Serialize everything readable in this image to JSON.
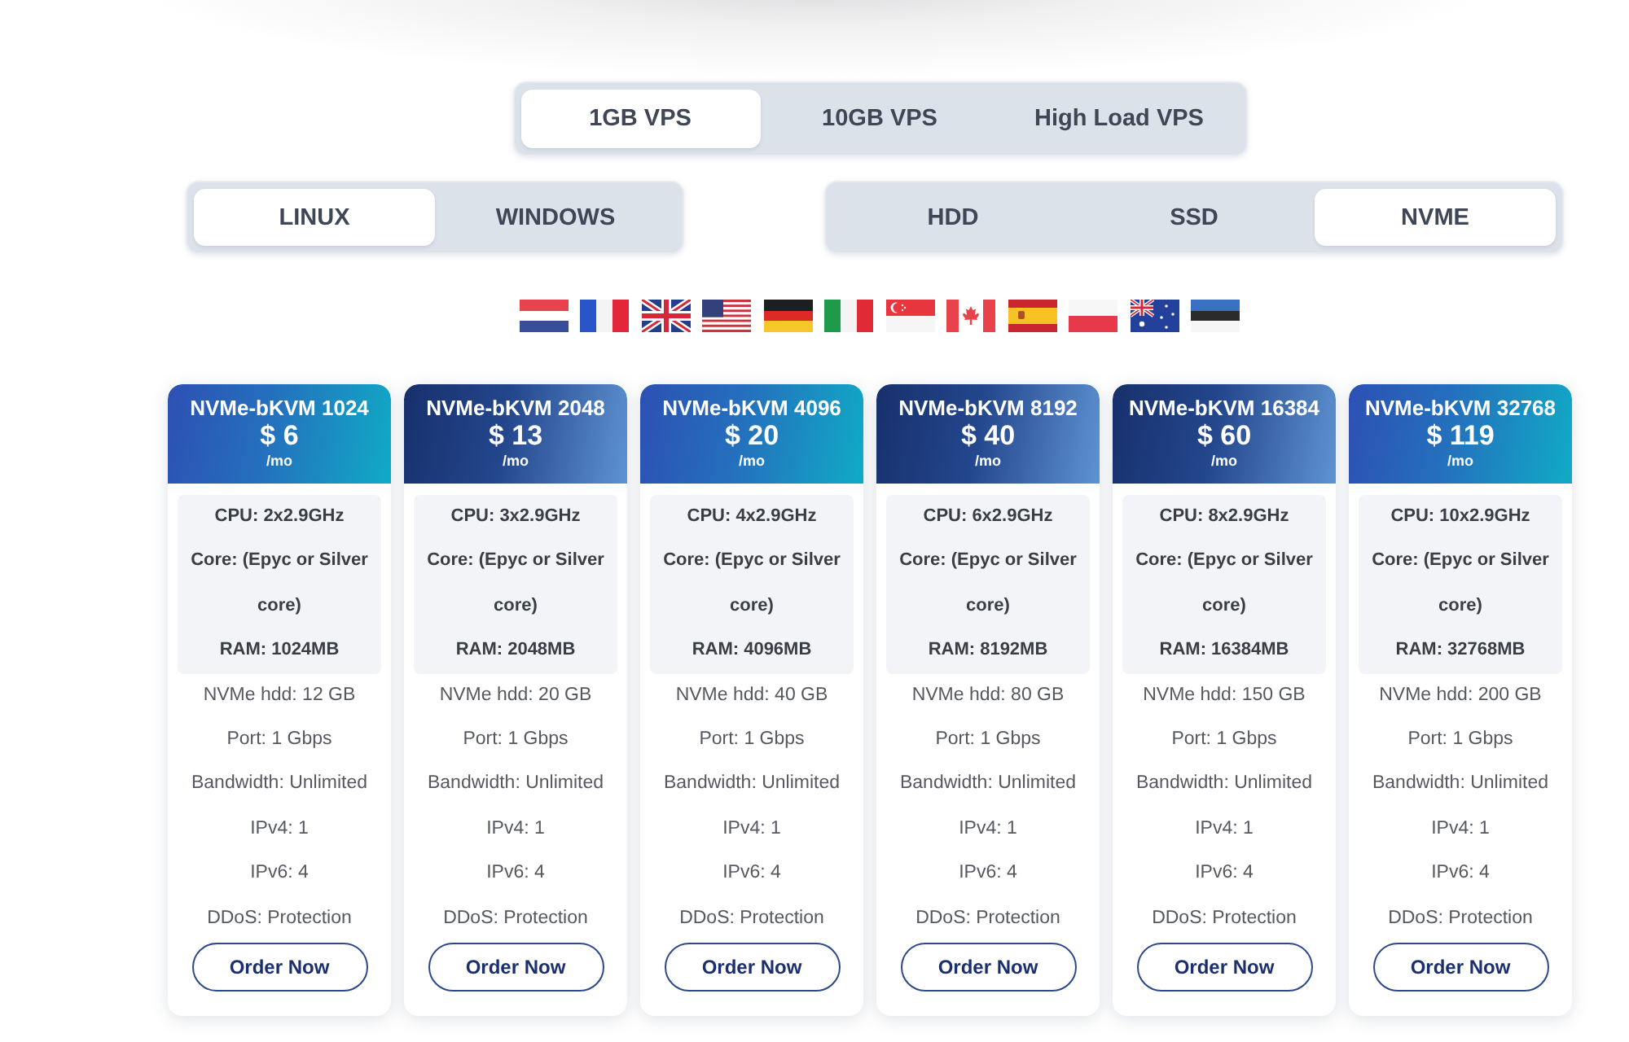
{
  "plan_tabs": [
    {
      "label": "1GB VPS",
      "selected": true
    },
    {
      "label": "10GB VPS",
      "selected": false
    },
    {
      "label": "High Load VPS",
      "selected": false
    }
  ],
  "os_tabs": [
    {
      "label": "LINUX",
      "selected": true
    },
    {
      "label": "WINDOWS",
      "selected": false
    }
  ],
  "disk_tabs": [
    {
      "label": "HDD",
      "selected": false
    },
    {
      "label": "SSD",
      "selected": false
    },
    {
      "label": "NVME",
      "selected": true
    }
  ],
  "locations": [
    {
      "kind": "nl"
    },
    {
      "kind": "fr"
    },
    {
      "kind": "gb"
    },
    {
      "kind": "us"
    },
    {
      "kind": "de"
    },
    {
      "kind": "it"
    },
    {
      "kind": "sg"
    },
    {
      "kind": "ca"
    },
    {
      "kind": "es"
    },
    {
      "kind": "pl"
    },
    {
      "kind": "au"
    },
    {
      "kind": "ee"
    }
  ],
  "plans": [
    {
      "kind": "teal",
      "name": "NVMe-bKVM 1024",
      "price": "$ 6",
      "period": "/mo",
      "highlights": [
        "CPU: 2x2.9GHz",
        "Core: (Epyc or Silver core)",
        "RAM: 1024MB"
      ],
      "specs": [
        "NVMe hdd: 12 GB",
        "Port: 1 Gbps",
        "Bandwidth: Unlimited",
        "IPv4: 1",
        "IPv6: 4",
        "DDoS: Protection"
      ],
      "button": "Order Now"
    },
    {
      "kind": "navy",
      "name": "NVMe-bKVM 2048",
      "price": "$ 13",
      "period": "/mo",
      "highlights": [
        "CPU: 3x2.9GHz",
        "Core: (Epyc or Silver core)",
        "RAM: 2048MB"
      ],
      "specs": [
        "NVMe hdd: 20 GB",
        "Port: 1 Gbps",
        "Bandwidth: Unlimited",
        "IPv4: 1",
        "IPv6: 4",
        "DDoS: Protection"
      ],
      "button": "Order Now"
    },
    {
      "kind": "teal",
      "name": "NVMe-bKVM 4096",
      "price": "$ 20",
      "period": "/mo",
      "highlights": [
        "CPU: 4x2.9GHz",
        "Core: (Epyc or Silver core)",
        "RAM: 4096MB"
      ],
      "specs": [
        "NVMe hdd: 40 GB",
        "Port: 1 Gbps",
        "Bandwidth: Unlimited",
        "IPv4: 1",
        "IPv6: 4",
        "DDoS: Protection"
      ],
      "button": "Order Now"
    },
    {
      "kind": "navy",
      "name": "NVMe-bKVM 8192",
      "price": "$ 40",
      "period": "/mo",
      "highlights": [
        "CPU: 6x2.9GHz",
        "Core: (Epyc or Silver core)",
        "RAM: 8192MB"
      ],
      "specs": [
        "NVMe hdd: 80 GB",
        "Port: 1 Gbps",
        "Bandwidth: Unlimited",
        "IPv4: 1",
        "IPv6: 4",
        "DDoS: Protection"
      ],
      "button": "Order Now"
    },
    {
      "kind": "navy",
      "name": "NVMe-bKVM 16384",
      "price": "$ 60",
      "period": "/mo",
      "highlights": [
        "CPU: 8x2.9GHz",
        "Core: (Epyc or Silver core)",
        "RAM: 16384MB"
      ],
      "specs": [
        "NVMe hdd: 150 GB",
        "Port: 1 Gbps",
        "Bandwidth: Unlimited",
        "IPv4: 1",
        "IPv6: 4",
        "DDoS: Protection"
      ],
      "button": "Order Now"
    },
    {
      "kind": "teal",
      "name": "NVMe-bKVM 32768",
      "price": "$ 119",
      "period": "/mo",
      "highlights": [
        "CPU: 10x2.9GHz",
        "Core: (Epyc or Silver core)",
        "RAM: 32768MB"
      ],
      "specs": [
        "NVMe hdd: 200 GB",
        "Port: 1 Gbps",
        "Bandwidth: Unlimited",
        "IPv4: 1",
        "IPv6: 4",
        "DDoS: Protection"
      ],
      "button": "Order Now"
    }
  ]
}
